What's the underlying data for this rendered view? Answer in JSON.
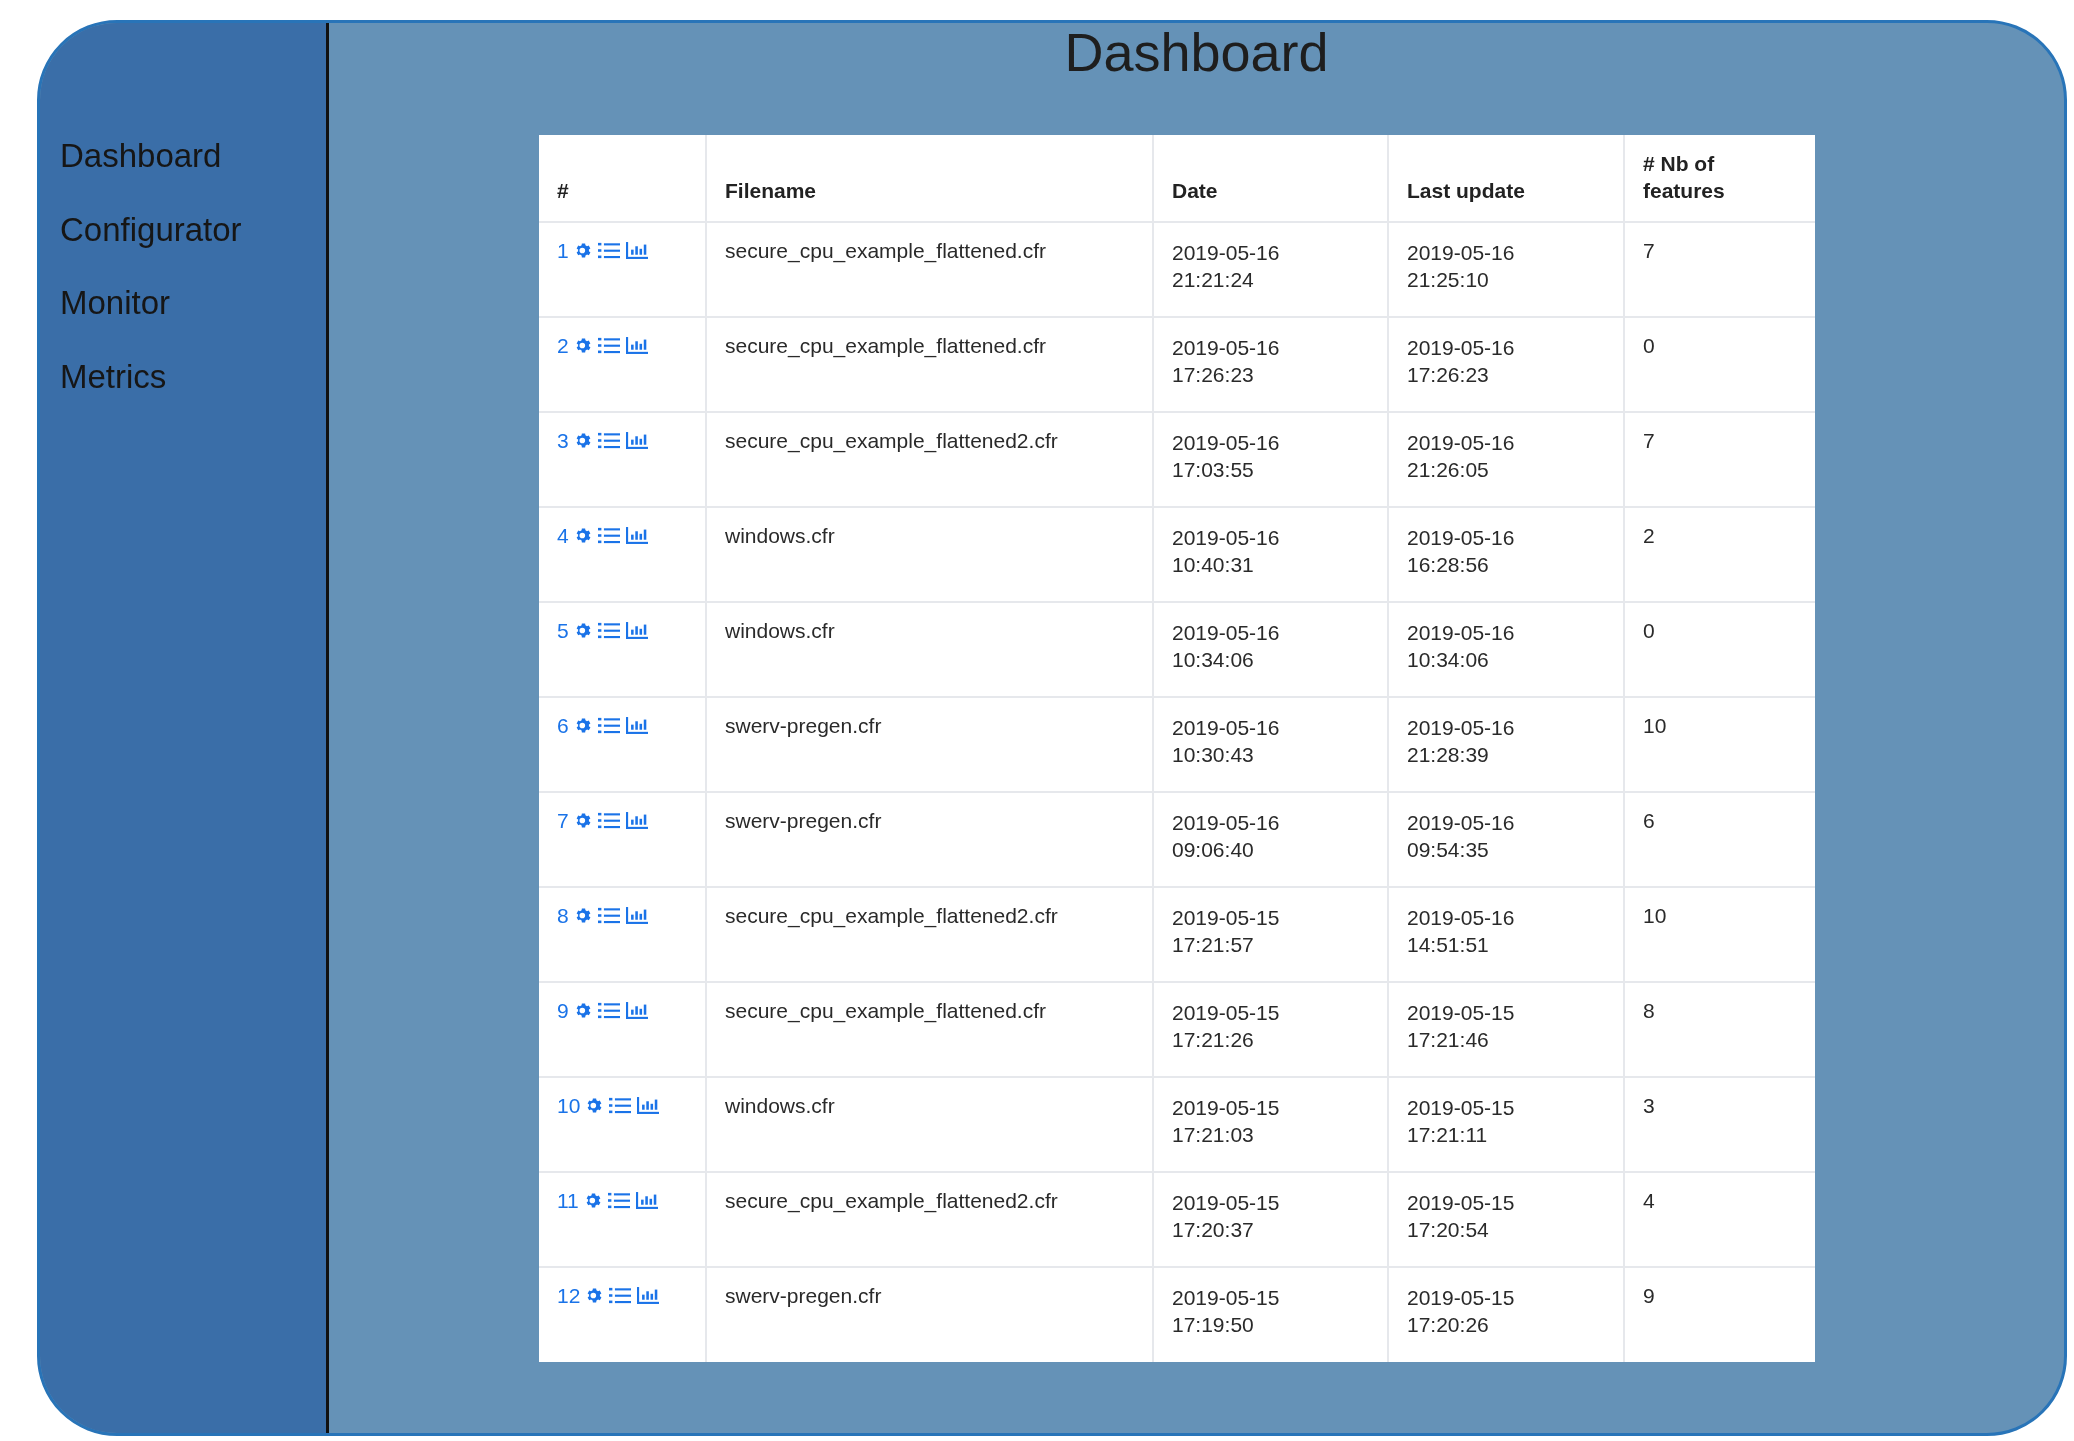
{
  "sidebar": {
    "items": [
      {
        "label": "Dashboard"
      },
      {
        "label": "Configurator"
      },
      {
        "label": "Monitor"
      },
      {
        "label": "Metrics"
      }
    ]
  },
  "page_title": "Dashboard",
  "table": {
    "columns": [
      "#",
      "Filename",
      "Date",
      "Last update",
      "# Nb of features"
    ],
    "rows": [
      {
        "number": "1",
        "filename": "secure_cpu_example_flattened.cfr",
        "date": [
          "2019-05-16",
          "21:21:24"
        ],
        "last_update": [
          "2019-05-16",
          "21:25:10"
        ],
        "features": "7"
      },
      {
        "number": "2",
        "filename": "secure_cpu_example_flattened.cfr",
        "date": [
          "2019-05-16",
          "17:26:23"
        ],
        "last_update": [
          "2019-05-16",
          "17:26:23"
        ],
        "features": "0"
      },
      {
        "number": "3",
        "filename": "secure_cpu_example_flattened2.cfr",
        "date": [
          "2019-05-16",
          "17:03:55"
        ],
        "last_update": [
          "2019-05-16",
          "21:26:05"
        ],
        "features": "7"
      },
      {
        "number": "4",
        "filename": "windows.cfr",
        "date": [
          "2019-05-16",
          "10:40:31"
        ],
        "last_update": [
          "2019-05-16",
          "16:28:56"
        ],
        "features": "2"
      },
      {
        "number": "5",
        "filename": "windows.cfr",
        "date": [
          "2019-05-16",
          "10:34:06"
        ],
        "last_update": [
          "2019-05-16",
          "10:34:06"
        ],
        "features": "0"
      },
      {
        "number": "6",
        "filename": "swerv-pregen.cfr",
        "date": [
          "2019-05-16",
          "10:30:43"
        ],
        "last_update": [
          "2019-05-16",
          "21:28:39"
        ],
        "features": "10"
      },
      {
        "number": "7",
        "filename": "swerv-pregen.cfr",
        "date": [
          "2019-05-16",
          "09:06:40"
        ],
        "last_update": [
          "2019-05-16",
          "09:54:35"
        ],
        "features": "6"
      },
      {
        "number": "8",
        "filename": "secure_cpu_example_flattened2.cfr",
        "date": [
          "2019-05-15",
          "17:21:57"
        ],
        "last_update": [
          "2019-05-16",
          "14:51:51"
        ],
        "features": "10"
      },
      {
        "number": "9",
        "filename": "secure_cpu_example_flattened.cfr",
        "date": [
          "2019-05-15",
          "17:21:26"
        ],
        "last_update": [
          "2019-05-15",
          "17:21:46"
        ],
        "features": "8"
      },
      {
        "number": "10",
        "filename": "windows.cfr",
        "date": [
          "2019-05-15",
          "17:21:03"
        ],
        "last_update": [
          "2019-05-15",
          "17:21:11"
        ],
        "features": "3"
      },
      {
        "number": "11",
        "filename": "secure_cpu_example_flattened2.cfr",
        "date": [
          "2019-05-15",
          "17:20:37"
        ],
        "last_update": [
          "2019-05-15",
          "17:20:54"
        ],
        "features": "4"
      },
      {
        "number": "12",
        "filename": "swerv-pregen.cfr",
        "date": [
          "2019-05-15",
          "17:19:50"
        ],
        "last_update": [
          "2019-05-15",
          "17:20:26"
        ],
        "features": "9"
      }
    ]
  }
}
